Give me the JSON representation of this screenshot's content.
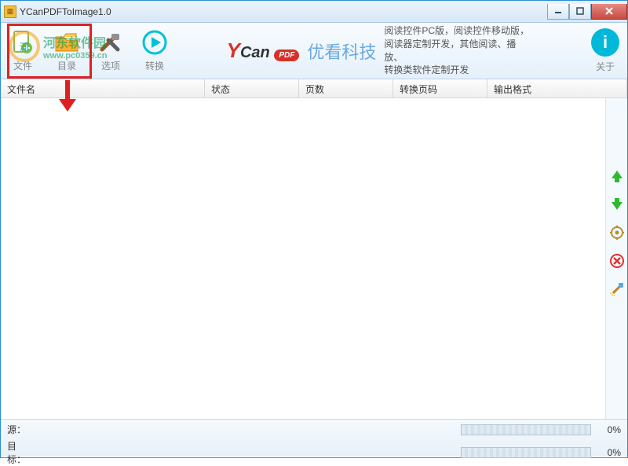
{
  "window": {
    "title": "YCanPDFToImage1.0"
  },
  "toolbar": {
    "file": {
      "label": "文件"
    },
    "folder": {
      "label": "目录"
    },
    "options": {
      "label": "选项"
    },
    "convert": {
      "label": "转换"
    },
    "about": {
      "label": "关于"
    }
  },
  "brand": {
    "logo_main": "Can",
    "logo_pdf": "PDF",
    "cn": "优看科技",
    "desc_l1": "阅读控件PC版，阅读控件移动版，",
    "desc_l2": "阅读器定制开发，其他阅读、播放、",
    "desc_l3": "转换类软件定制开发"
  },
  "watermark": {
    "text": "河东软件园",
    "url": "www.pc0359.cn"
  },
  "columns": {
    "c1": "文件名",
    "c2": "状态",
    "c3": "页数",
    "c4": "转换页码",
    "c5": "输出格式"
  },
  "status": {
    "source_label": "源：",
    "target_label": "目标：",
    "source_pct": "0%",
    "target_pct": "0%"
  }
}
